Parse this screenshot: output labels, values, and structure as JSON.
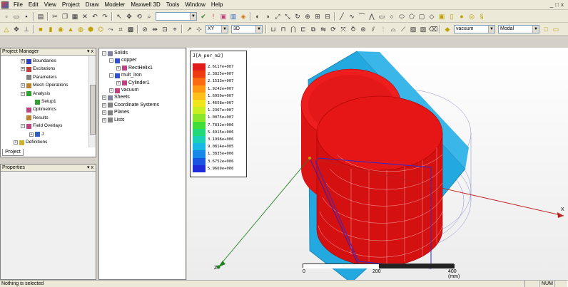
{
  "menubar": {
    "items": [
      "File",
      "Edit",
      "View",
      "Project",
      "Draw",
      "Modeler",
      "Maxwell 3D",
      "Tools",
      "Window",
      "Help"
    ],
    "window_controls": [
      "_",
      "□",
      "x"
    ]
  },
  "toolbar": {
    "plane_select": "XY",
    "view_select": "3D",
    "material_select": "vacuum",
    "mode_select": "Modal"
  },
  "project_manager": {
    "title": "Project Manager",
    "title_controls": "▾ x",
    "tab_label": "Project",
    "tree": [
      {
        "label": "Boundaries",
        "exp": "+",
        "icon": "boundary-icon"
      },
      {
        "label": "Excitations",
        "exp": "+",
        "icon": "excitation-icon"
      },
      {
        "label": "Parameters",
        "exp": "",
        "icon": "parameter-icon"
      },
      {
        "label": "Mesh Operations",
        "exp": "+",
        "icon": "mesh-icon"
      },
      {
        "label": "Analysis",
        "exp": "-",
        "icon": "analysis-icon"
      },
      {
        "label": "Setup1",
        "exp": "",
        "icon": "setup-icon"
      },
      {
        "label": "Optimetrics",
        "exp": "",
        "icon": "optimetrics-icon"
      },
      {
        "label": "Results",
        "exp": "",
        "icon": "results-icon"
      },
      {
        "label": "Field Overlays",
        "exp": "-",
        "icon": "field-overlay-icon"
      },
      {
        "label": "J",
        "exp": "+",
        "icon": "field-plot-icon"
      },
      {
        "label": "Definitions",
        "exp": "+",
        "icon": "folder-icon"
      }
    ]
  },
  "properties": {
    "title": "Properties",
    "title_controls": "▾ x"
  },
  "model_tree": {
    "items": [
      {
        "label": "Solids",
        "exp": "-",
        "icon": "solids-icon"
      },
      {
        "label": "copper",
        "exp": "-",
        "icon": "material-icon"
      },
      {
        "label": "RectHelix1",
        "exp": "+",
        "icon": "object-icon"
      },
      {
        "label": "mult_iron",
        "exp": "-",
        "icon": "material-icon"
      },
      {
        "label": "Cylinder1",
        "exp": "+",
        "icon": "object-icon"
      },
      {
        "label": "vacuum",
        "exp": "+",
        "icon": "material-icon"
      },
      {
        "label": "Sheets",
        "exp": "+",
        "icon": "sheets-icon"
      },
      {
        "label": "Coordinate Systems",
        "exp": "+",
        "icon": "coordinate-icon"
      },
      {
        "label": "Planes",
        "exp": "+",
        "icon": "planes-icon"
      },
      {
        "label": "Lists",
        "exp": "+",
        "icon": "lists-icon"
      }
    ]
  },
  "legend": {
    "title": "J[A_per_m2]",
    "entries": [
      {
        "value": "2.6117e+007",
        "color": "#e11b1b"
      },
      {
        "value": "2.3825e+007",
        "color": "#f03a12"
      },
      {
        "value": "2.1533e+007",
        "color": "#fb6a10"
      },
      {
        "value": "1.9242e+007",
        "color": "#fe9712"
      },
      {
        "value": "1.6950e+007",
        "color": "#ffc01a"
      },
      {
        "value": "1.4658e+007",
        "color": "#f1e51c"
      },
      {
        "value": "1.2367e+007",
        "color": "#c9ef22"
      },
      {
        "value": "1.0075e+007",
        "color": "#8ae62a"
      },
      {
        "value": "7.7832e+006",
        "color": "#3fdc3a"
      },
      {
        "value": "5.4915e+006",
        "color": "#22d67a"
      },
      {
        "value": "3.1998e+006",
        "color": "#1ad1b7"
      },
      {
        "value": "9.0814e+005",
        "color": "#17b8e3"
      },
      {
        "value": "1.3835e+006",
        "color": "#1888e8"
      },
      {
        "value": "3.6752e+006",
        "color": "#1a55e2"
      },
      {
        "value": "5.9669e+006",
        "color": "#1f2ad8"
      }
    ]
  },
  "scale_bar": {
    "ticks": [
      "0",
      "200",
      "400 (mm)"
    ]
  },
  "axes": {
    "z": "Z",
    "x": "X"
  },
  "status": {
    "message": "Nothing is selected",
    "num": "NUM"
  }
}
